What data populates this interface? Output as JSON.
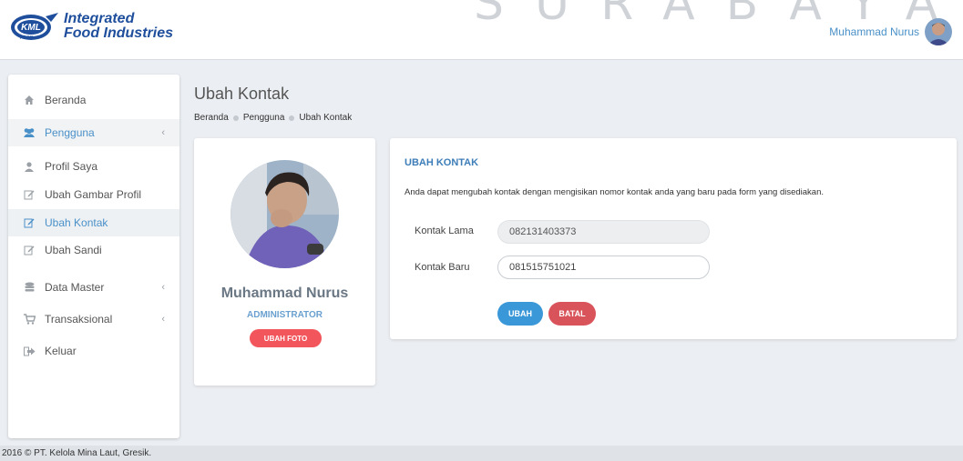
{
  "header": {
    "brand_line1": "Integrated",
    "brand_line2": "Food Industries",
    "logo_text": "KML",
    "logo_sub": "FOOD",
    "watermark": "SURABAYA",
    "user_name": "Muhammad Nurus"
  },
  "sidebar": {
    "items": [
      {
        "label": "Beranda",
        "icon": "home-icon"
      },
      {
        "label": "Pengguna",
        "icon": "users-icon"
      },
      {
        "label": "Profil Saya",
        "icon": "user-icon"
      },
      {
        "label": "Ubah Gambar Profil",
        "icon": "edit-icon"
      },
      {
        "label": "Ubah Kontak",
        "icon": "edit-icon"
      },
      {
        "label": "Ubah Sandi",
        "icon": "edit-icon"
      },
      {
        "label": "Data Master",
        "icon": "database-icon"
      },
      {
        "label": "Transaksional",
        "icon": "cart-icon"
      },
      {
        "label": "Keluar",
        "icon": "logout-icon"
      }
    ]
  },
  "page": {
    "title": "Ubah Kontak",
    "breadcrumb": [
      "Beranda",
      "Pengguna",
      "Ubah Kontak"
    ]
  },
  "profile": {
    "name": "Muhammad Nurus",
    "role": "ADMINISTRATOR",
    "photo_button": "UBAH FOTO"
  },
  "form": {
    "heading": "UBAH KONTAK",
    "description": "Anda dapat mengubah kontak dengan mengisikan nomor kontak anda yang baru pada form yang disediakan.",
    "old_label": "Kontak Lama",
    "old_value": "082131403373",
    "new_label": "Kontak Baru",
    "new_value": "081515751021",
    "submit_label": "UBAH",
    "cancel_label": "BATAL"
  },
  "footer": {
    "text": "2016 © PT. Kelola Mina Laut, Gresik."
  },
  "colors": {
    "accent": "#4a90c8",
    "primary_button": "#3a97d8",
    "danger_button": "#d9545a",
    "photo_button": "#f2565c"
  }
}
